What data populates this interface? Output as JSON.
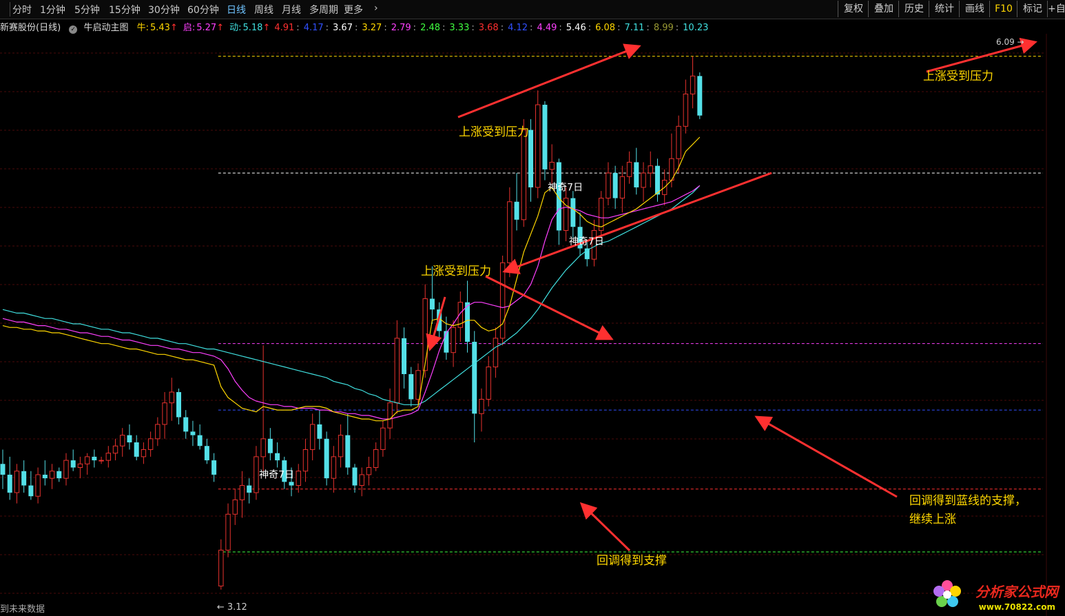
{
  "toolbar": {
    "periods": [
      "分时",
      "1分钟",
      "5分钟",
      "15分钟",
      "30分钟",
      "60分钟",
      "日线",
      "周线",
      "月线",
      "多周期",
      "更多"
    ],
    "active_period": "日线",
    "right_buttons": [
      "复权",
      "叠加",
      "历史",
      "统计",
      "画线",
      "F10",
      "标记",
      "+自"
    ]
  },
  "legend": {
    "stock_name": "新赛股份(日线)",
    "indicator_name": "牛启动主图",
    "items": [
      {
        "label": "牛:",
        "value": "5.43",
        "color": "#ffd700"
      },
      {
        "label": "启:",
        "value": "5.27",
        "color": "#ff40ff"
      },
      {
        "label": "动:",
        "value": "5.18",
        "color": "#40e0e0"
      }
    ],
    "up_arrow": "↑",
    "levels": [
      {
        "value": "4.91",
        "color": "#ff3030"
      },
      {
        "value": "4.17",
        "color": "#3050ff"
      },
      {
        "value": "3.67",
        "color": "#ffffff"
      },
      {
        "value": "3.27",
        "color": "#ffd700"
      },
      {
        "value": "2.79",
        "color": "#ff40ff"
      },
      {
        "value": "2.48",
        "color": "#40ff40"
      },
      {
        "value": "3.33",
        "color": "#40ff40"
      },
      {
        "value": "3.68",
        "color": "#ff3030"
      },
      {
        "value": "4.12",
        "color": "#3050ff"
      },
      {
        "value": "4.49",
        "color": "#ff40ff"
      },
      {
        "value": "5.46",
        "color": "#ffffff"
      },
      {
        "value": "6.08",
        "color": "#ffd700"
      },
      {
        "value": "7.11",
        "color": "#40e0e0"
      },
      {
        "value": "8.99",
        "color": "#999933"
      },
      {
        "value": "10.23",
        "color": "#40e0e0"
      }
    ]
  },
  "annotations": {
    "pressure_1": "上涨受到压力",
    "pressure_2": "上涨受到压力",
    "pressure_3": "上涨受到压力",
    "support_1": "回调得到支撑",
    "support_blue_line_1": "回调得到蓝线的支撑，",
    "support_blue_line_2": "继续上涨",
    "magic_day": "神奇7日"
  },
  "price_labels": {
    "low": "3.12",
    "high": "6.09"
  },
  "future_data_label": "到未来数据",
  "watermark": {
    "title": "分析家公式网",
    "url": "www.70822.com"
  },
  "colors": {
    "up": "#e8322e",
    "down": "#54e0e8",
    "ma_yellow": "#ffd700",
    "ma_magenta": "#ff40ff",
    "ma_cyan": "#40e0e0",
    "arrow": "#ff3030"
  },
  "chart_data": {
    "type": "candlestick",
    "price_range": [
      3.0,
      6.2
    ],
    "reference_levels": [
      {
        "price": 6.09,
        "color": "#ffd700"
      },
      {
        "price": 5.44,
        "color": "#ffffff"
      },
      {
        "price": 4.49,
        "color": "#ff40ff"
      },
      {
        "price": 4.12,
        "color": "#3050ff"
      },
      {
        "price": 3.68,
        "color": "#ff3030"
      },
      {
        "price": 3.33,
        "color": "#40ff40"
      }
    ],
    "candles": [
      [
        3.82,
        3.9,
        3.68,
        3.76
      ],
      [
        3.76,
        3.86,
        3.62,
        3.66
      ],
      [
        3.66,
        3.82,
        3.6,
        3.78
      ],
      [
        3.78,
        3.84,
        3.66,
        3.7
      ],
      [
        3.7,
        3.78,
        3.62,
        3.64
      ],
      [
        3.64,
        3.8,
        3.6,
        3.76
      ],
      [
        3.76,
        3.84,
        3.7,
        3.74
      ],
      [
        3.74,
        3.82,
        3.68,
        3.78
      ],
      [
        3.78,
        3.8,
        3.72,
        3.74
      ],
      [
        3.74,
        3.88,
        3.7,
        3.84
      ],
      [
        3.84,
        3.9,
        3.78,
        3.8
      ],
      [
        3.8,
        3.86,
        3.74,
        3.82
      ],
      [
        3.82,
        3.88,
        3.76,
        3.86
      ],
      [
        3.86,
        3.9,
        3.8,
        3.84
      ],
      [
        3.84,
        3.86,
        3.82,
        3.84
      ],
      [
        3.84,
        3.92,
        3.8,
        3.88
      ],
      [
        3.88,
        3.96,
        3.84,
        3.92
      ],
      [
        3.92,
        4.02,
        3.86,
        3.98
      ],
      [
        3.98,
        4.04,
        3.9,
        3.94
      ],
      [
        3.94,
        3.98,
        3.84,
        3.86
      ],
      [
        3.86,
        3.94,
        3.82,
        3.9
      ],
      [
        3.9,
        4.0,
        3.86,
        3.96
      ],
      [
        3.96,
        4.08,
        3.92,
        4.04
      ],
      [
        4.04,
        4.22,
        3.96,
        4.16
      ],
      [
        4.16,
        4.3,
        4.06,
        4.22
      ],
      [
        4.22,
        4.24,
        4.04,
        4.08
      ],
      [
        4.08,
        4.12,
        3.96,
        4.0
      ],
      [
        4.0,
        4.06,
        3.92,
        3.98
      ],
      [
        3.98,
        4.04,
        3.9,
        3.92
      ],
      [
        3.92,
        3.96,
        3.82,
        3.84
      ],
      [
        3.84,
        3.88,
        3.72,
        3.76
      ],
      [
        3.14,
        3.4,
        3.12,
        3.34
      ],
      [
        3.34,
        3.6,
        3.3,
        3.54
      ],
      [
        3.54,
        3.68,
        3.48,
        3.62
      ],
      [
        3.62,
        3.78,
        3.52,
        3.7
      ],
      [
        3.7,
        3.74,
        3.6,
        3.66
      ],
      [
        3.66,
        3.92,
        3.62,
        3.86
      ],
      [
        3.86,
        4.48,
        3.78,
        3.96
      ],
      [
        3.96,
        4.02,
        3.84,
        3.88
      ],
      [
        3.88,
        3.94,
        3.8,
        3.84
      ],
      [
        3.84,
        3.86,
        3.68,
        3.72
      ],
      [
        3.72,
        3.8,
        3.64,
        3.7
      ],
      [
        3.7,
        3.82,
        3.66,
        3.78
      ],
      [
        3.78,
        3.96,
        3.72,
        3.9
      ],
      [
        3.9,
        4.1,
        3.84,
        4.04
      ],
      [
        4.04,
        4.12,
        3.9,
        3.96
      ],
      [
        3.96,
        4.0,
        3.7,
        3.74
      ],
      [
        3.74,
        3.92,
        3.66,
        3.86
      ],
      [
        3.86,
        4.04,
        3.8,
        3.98
      ],
      [
        3.98,
        4.1,
        3.76,
        3.8
      ],
      [
        3.8,
        3.82,
        3.66,
        3.7
      ],
      [
        3.7,
        3.8,
        3.64,
        3.76
      ],
      [
        3.76,
        3.86,
        3.7,
        3.8
      ],
      [
        3.8,
        3.94,
        3.78,
        3.9
      ],
      [
        3.9,
        4.06,
        3.86,
        4.02
      ],
      [
        4.02,
        4.24,
        3.96,
        4.16
      ],
      [
        4.16,
        4.62,
        4.1,
        4.52
      ],
      [
        4.52,
        4.58,
        4.24,
        4.32
      ],
      [
        4.32,
        4.36,
        4.14,
        4.18
      ],
      [
        4.18,
        4.38,
        4.14,
        4.34
      ],
      [
        4.34,
        4.82,
        4.3,
        4.74
      ],
      [
        4.74,
        4.92,
        4.6,
        4.68
      ],
      [
        4.68,
        4.72,
        4.52,
        4.56
      ],
      [
        4.56,
        4.64,
        4.4,
        4.44
      ],
      [
        4.44,
        4.62,
        4.36,
        4.58
      ],
      [
        4.58,
        4.78,
        4.5,
        4.72
      ],
      [
        4.72,
        4.84,
        4.44,
        4.5
      ],
      [
        4.5,
        4.56,
        3.94,
        4.1
      ],
      [
        4.1,
        4.24,
        4.0,
        4.18
      ],
      [
        4.18,
        4.42,
        4.14,
        4.36
      ],
      [
        4.36,
        4.58,
        4.3,
        4.52
      ],
      [
        4.52,
        4.98,
        4.48,
        4.94
      ],
      [
        4.94,
        5.36,
        4.86,
        5.28
      ],
      [
        5.28,
        5.44,
        5.12,
        5.18
      ],
      [
        5.18,
        5.74,
        5.14,
        5.68
      ],
      [
        5.68,
        5.74,
        5.28,
        5.36
      ],
      [
        5.36,
        5.9,
        5.3,
        5.82
      ],
      [
        5.82,
        5.84,
        5.4,
        5.46
      ],
      [
        5.46,
        5.6,
        5.38,
        5.5
      ],
      [
        5.5,
        5.52,
        5.04,
        5.12
      ],
      [
        5.12,
        5.36,
        5.06,
        5.3
      ],
      [
        5.3,
        5.34,
        5.08,
        5.14
      ],
      [
        5.14,
        5.22,
        4.98,
        5.02
      ],
      [
        5.02,
        5.06,
        4.92,
        4.96
      ],
      [
        4.96,
        5.18,
        4.92,
        5.12
      ],
      [
        5.12,
        5.34,
        5.08,
        5.3
      ],
      [
        5.3,
        5.5,
        5.26,
        5.44
      ],
      [
        5.44,
        5.48,
        5.24,
        5.3
      ],
      [
        5.3,
        5.48,
        5.22,
        5.42
      ],
      [
        5.42,
        5.56,
        5.38,
        5.5
      ],
      [
        5.5,
        5.58,
        5.32,
        5.36
      ],
      [
        5.36,
        5.5,
        5.28,
        5.44
      ],
      [
        5.44,
        5.56,
        5.36,
        5.48
      ],
      [
        5.48,
        5.52,
        5.28,
        5.32
      ],
      [
        5.32,
        5.46,
        5.26,
        5.4
      ],
      [
        5.4,
        5.66,
        5.36,
        5.52
      ],
      [
        5.52,
        5.76,
        5.44,
        5.7
      ],
      [
        5.7,
        5.96,
        5.66,
        5.88
      ],
      [
        5.88,
        6.09,
        5.8,
        5.98
      ],
      [
        5.98,
        6.0,
        5.74,
        5.76
      ]
    ],
    "ma_yellow": [
      4.59,
      4.58,
      4.58,
      4.57,
      4.57,
      4.56,
      4.56,
      4.55,
      4.55,
      4.54,
      4.53,
      4.52,
      4.51,
      4.5,
      4.49,
      4.49,
      4.48,
      4.47,
      4.46,
      4.46,
      4.45,
      4.44,
      4.43,
      4.43,
      4.42,
      4.41,
      4.4,
      4.4,
      4.39,
      4.38,
      4.37,
      4.25,
      4.19,
      4.16,
      4.13,
      4.12,
      4.11,
      4.14,
      4.13,
      4.12,
      4.12,
      4.12,
      4.13,
      4.14,
      4.14,
      4.14,
      4.13,
      4.11,
      4.1,
      4.09,
      4.08,
      4.07,
      4.07,
      4.06,
      4.06,
      4.07,
      4.11,
      4.12,
      4.12,
      4.14,
      4.38,
      4.62,
      4.63,
      4.6,
      4.59,
      4.6,
      4.62,
      4.62,
      4.58,
      4.56,
      4.57,
      4.6,
      4.7,
      4.85,
      5.0,
      5.1,
      5.2,
      5.33,
      5.36,
      5.3,
      5.26,
      5.24,
      5.21,
      5.17,
      5.15,
      5.14,
      5.16,
      5.18,
      5.2,
      5.22,
      5.24,
      5.27,
      5.3,
      5.33,
      5.36,
      5.4,
      5.47,
      5.56,
      5.6,
      5.64
    ],
    "ma_magenta": [
      4.63,
      4.62,
      4.61,
      4.61,
      4.6,
      4.59,
      4.59,
      4.58,
      4.57,
      4.57,
      4.56,
      4.55,
      4.55,
      4.54,
      4.53,
      4.53,
      4.52,
      4.51,
      4.51,
      4.5,
      4.49,
      4.48,
      4.48,
      4.47,
      4.46,
      4.46,
      4.45,
      4.44,
      4.44,
      4.43,
      4.42,
      4.4,
      4.35,
      4.28,
      4.23,
      4.19,
      4.17,
      4.16,
      4.15,
      4.15,
      4.14,
      4.14,
      4.13,
      4.13,
      4.13,
      4.12,
      4.12,
      4.11,
      4.11,
      4.1,
      4.1,
      4.09,
      4.09,
      4.08,
      4.07,
      4.07,
      4.08,
      4.09,
      4.1,
      4.12,
      4.22,
      4.33,
      4.45,
      4.55,
      4.6,
      4.66,
      4.7,
      4.72,
      4.72,
      4.71,
      4.7,
      4.69,
      4.7,
      4.73,
      4.76,
      4.82,
      4.92,
      5.06,
      5.18,
      5.24,
      5.25,
      5.24,
      5.23,
      5.21,
      5.2,
      5.19,
      5.19,
      5.2,
      5.21,
      5.22,
      5.23,
      5.24,
      5.25,
      5.26,
      5.27,
      5.28,
      5.3,
      5.32,
      5.34,
      5.37
    ],
    "ma_cyan": [
      4.68,
      4.67,
      4.66,
      4.66,
      4.65,
      4.64,
      4.63,
      4.63,
      4.62,
      4.61,
      4.6,
      4.6,
      4.59,
      4.58,
      4.57,
      4.57,
      4.56,
      4.55,
      4.55,
      4.54,
      4.53,
      4.52,
      4.52,
      4.51,
      4.5,
      4.49,
      4.49,
      4.48,
      4.47,
      4.46,
      4.46,
      4.45,
      4.44,
      4.43,
      4.42,
      4.41,
      4.4,
      4.39,
      4.38,
      4.37,
      4.36,
      4.35,
      4.34,
      4.33,
      4.32,
      4.31,
      4.3,
      4.28,
      4.27,
      4.26,
      4.24,
      4.23,
      4.21,
      4.2,
      4.18,
      4.17,
      4.16,
      4.15,
      4.15,
      4.15,
      4.17,
      4.2,
      4.23,
      4.26,
      4.29,
      4.32,
      4.35,
      4.38,
      4.41,
      4.44,
      4.47,
      4.49,
      4.52,
      4.55,
      4.59,
      4.63,
      4.68,
      4.74,
      4.8,
      4.85,
      4.9,
      4.94,
      4.98,
      5.01,
      5.03,
      5.05,
      5.06,
      5.08,
      5.1,
      5.12,
      5.14,
      5.16,
      5.18,
      5.2,
      5.22,
      5.24,
      5.27,
      5.3,
      5.33,
      5.37
    ],
    "magic_day_candles": [
      37,
      78,
      81
    ]
  }
}
